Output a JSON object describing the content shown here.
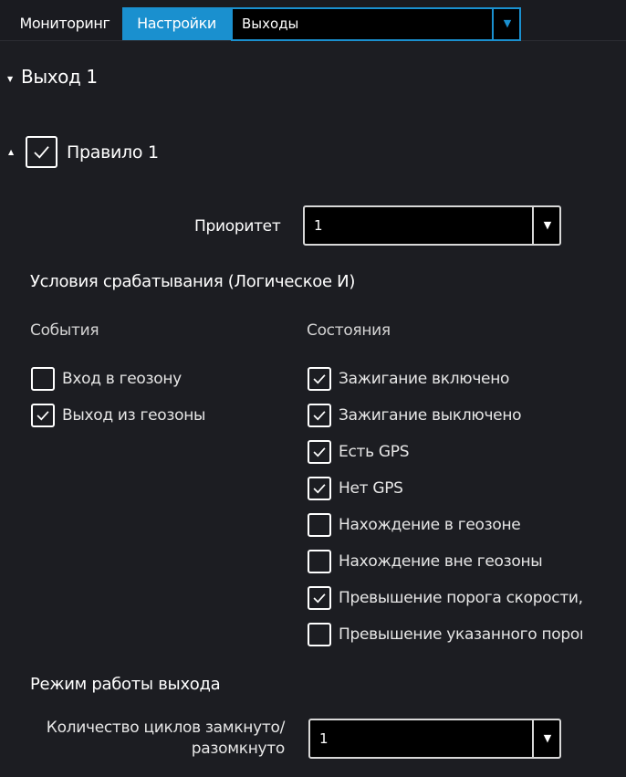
{
  "tabs": {
    "monitoring": "Мониторинг",
    "settings": "Настройки"
  },
  "section_select": {
    "value": "Выходы",
    "arrow_icon": "triangle-down-icon"
  },
  "output": {
    "title": "Выход 1",
    "expanded": true
  },
  "rule": {
    "title": "Правило 1",
    "enabled": true,
    "priority_label": "Приоритет",
    "priority_value": "1"
  },
  "conditions": {
    "heading": "Условия срабатывания (Логическое И)",
    "events_heading": "События",
    "states_heading": "Состояния",
    "events": [
      {
        "label": "Вход в геозону",
        "checked": false
      },
      {
        "label": "Выход из геозоны",
        "checked": true
      }
    ],
    "states": [
      {
        "label": "Зажигание включено",
        "checked": true
      },
      {
        "label": "Зажигание выключено",
        "checked": true
      },
      {
        "label": "Есть GPS",
        "checked": true
      },
      {
        "label": "Нет GPS",
        "checked": true
      },
      {
        "label": "Нахождение в геозоне",
        "checked": false
      },
      {
        "label": "Нахождение вне геозоны",
        "checked": false
      },
      {
        "label": "Превышение порога скорости,",
        "checked": true
      },
      {
        "label": "Превышение указанного порога",
        "checked": false
      }
    ]
  },
  "mode": {
    "heading": "Режим работы выхода",
    "cycles_label_line1": "Количество циклов замкнуто/",
    "cycles_label_line2": "разомкнуто",
    "cycles_value": "1"
  },
  "colors": {
    "accent": "#1a90cf",
    "background": "#1c1d22",
    "select_background": "#000000"
  }
}
